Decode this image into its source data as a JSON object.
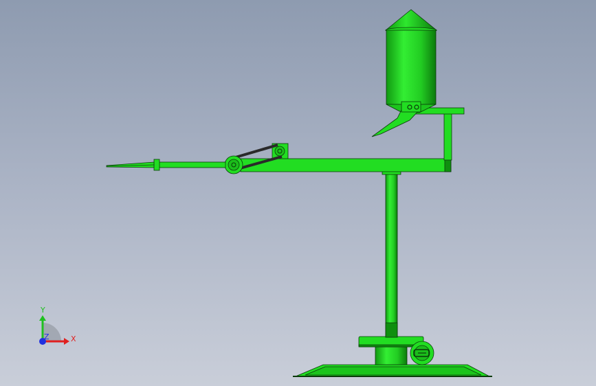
{
  "viewport": {
    "background_top": "#8e9bb0",
    "background_bottom": "#c9ced9"
  },
  "model": {
    "part_color": "#22dd22",
    "part_shadow": "#0f8f0f",
    "edge_color": "#0a3a0a",
    "belt_color": "#2a2a2a"
  },
  "triad": {
    "x_label": "X",
    "y_label": "Y",
    "z_label": "Z",
    "x_color": "#e02020",
    "y_color": "#20c020",
    "z_color": "#2030e0"
  }
}
